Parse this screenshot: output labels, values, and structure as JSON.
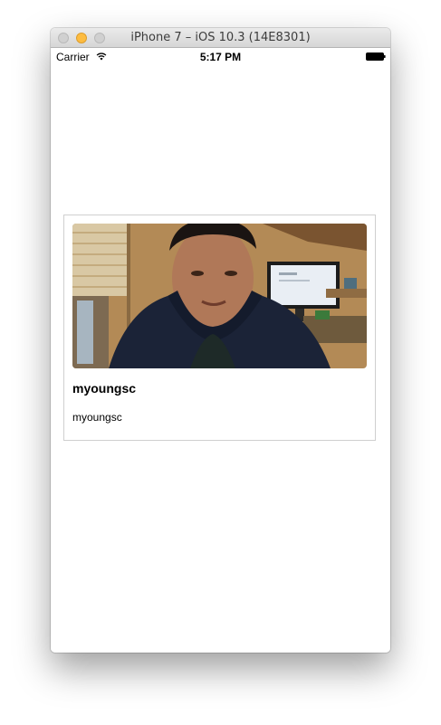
{
  "window": {
    "title": "iPhone 7 – iOS 10.3 (14E8301)"
  },
  "status_bar": {
    "carrier": "Carrier",
    "time": "5:17 PM",
    "wifi_icon": "wifi-icon",
    "battery_icon": "battery-icon"
  },
  "card": {
    "image": "profile-photo",
    "title": "myoungsc",
    "subtitle": "myoungsc"
  }
}
